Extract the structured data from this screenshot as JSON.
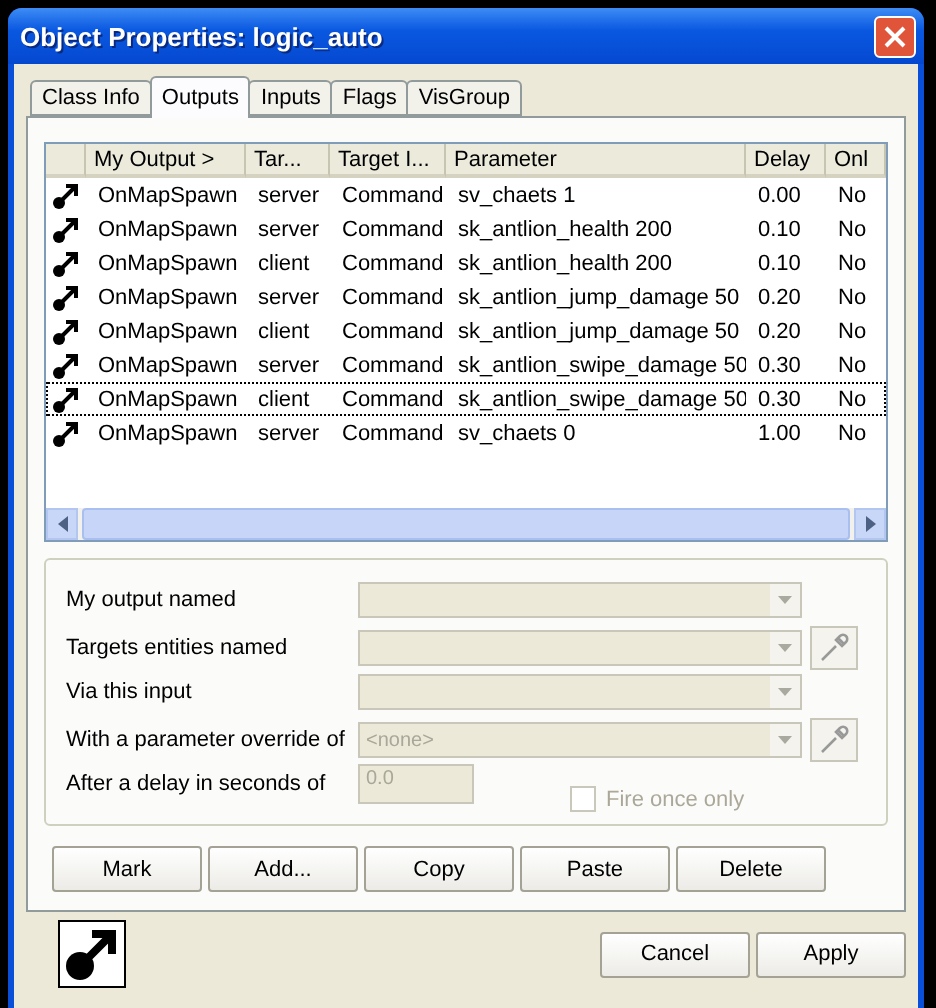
{
  "window": {
    "title": "Object Properties: logic_auto"
  },
  "tabs": [
    {
      "label": "Class Info",
      "selected": false
    },
    {
      "label": "Outputs",
      "selected": true
    },
    {
      "label": "Inputs",
      "selected": false
    },
    {
      "label": "Flags",
      "selected": false
    },
    {
      "label": "VisGroup",
      "selected": false
    }
  ],
  "table": {
    "columns": [
      "My Output >",
      "Tar...",
      "Target I...",
      "Parameter",
      "Delay",
      "Onl"
    ],
    "rows": [
      {
        "cells": [
          "OnMapSpawn",
          "server",
          "Command",
          "sv_chaets 1",
          "0.00",
          "No"
        ],
        "focused": false
      },
      {
        "cells": [
          "OnMapSpawn",
          "server",
          "Command",
          "sk_antlion_health 200",
          "0.10",
          "No"
        ],
        "focused": false
      },
      {
        "cells": [
          "OnMapSpawn",
          "client",
          "Command",
          "sk_antlion_health 200",
          "0.10",
          "No"
        ],
        "focused": false
      },
      {
        "cells": [
          "OnMapSpawn",
          "server",
          "Command",
          "sk_antlion_jump_damage 50",
          "0.20",
          "No"
        ],
        "focused": false
      },
      {
        "cells": [
          "OnMapSpawn",
          "client",
          "Command",
          "sk_antlion_jump_damage 50",
          "0.20",
          "No"
        ],
        "focused": false
      },
      {
        "cells": [
          "OnMapSpawn",
          "server",
          "Command",
          "sk_antlion_swipe_damage 50",
          "0.30",
          "No"
        ],
        "focused": false
      },
      {
        "cells": [
          "OnMapSpawn",
          "client",
          "Command",
          "sk_antlion_swipe_damage 50",
          "0.30",
          "No"
        ],
        "focused": true
      },
      {
        "cells": [
          "OnMapSpawn",
          "server",
          "Command",
          "sv_chaets 0",
          "1.00",
          "No"
        ],
        "focused": false
      }
    ]
  },
  "form": [
    {
      "label": "My output named",
      "kind": "combo",
      "picker": false
    },
    {
      "label": "Targets entities named",
      "kind": "combo",
      "picker": true
    },
    {
      "label": "Via this input",
      "kind": "combo",
      "picker": false
    },
    {
      "label": "With a parameter override of",
      "kind": "combo",
      "picker": true,
      "value": "<none>"
    },
    {
      "label": "After a delay in seconds of",
      "kind": "text",
      "value": "0.0"
    }
  ],
  "fire_once": {
    "label": "Fire once only",
    "checked": false,
    "disabled": true
  },
  "actions": [
    "Mark",
    "Add...",
    "Copy",
    "Paste",
    "Delete"
  ],
  "footer_buttons": [
    "Cancel",
    "Apply"
  ]
}
